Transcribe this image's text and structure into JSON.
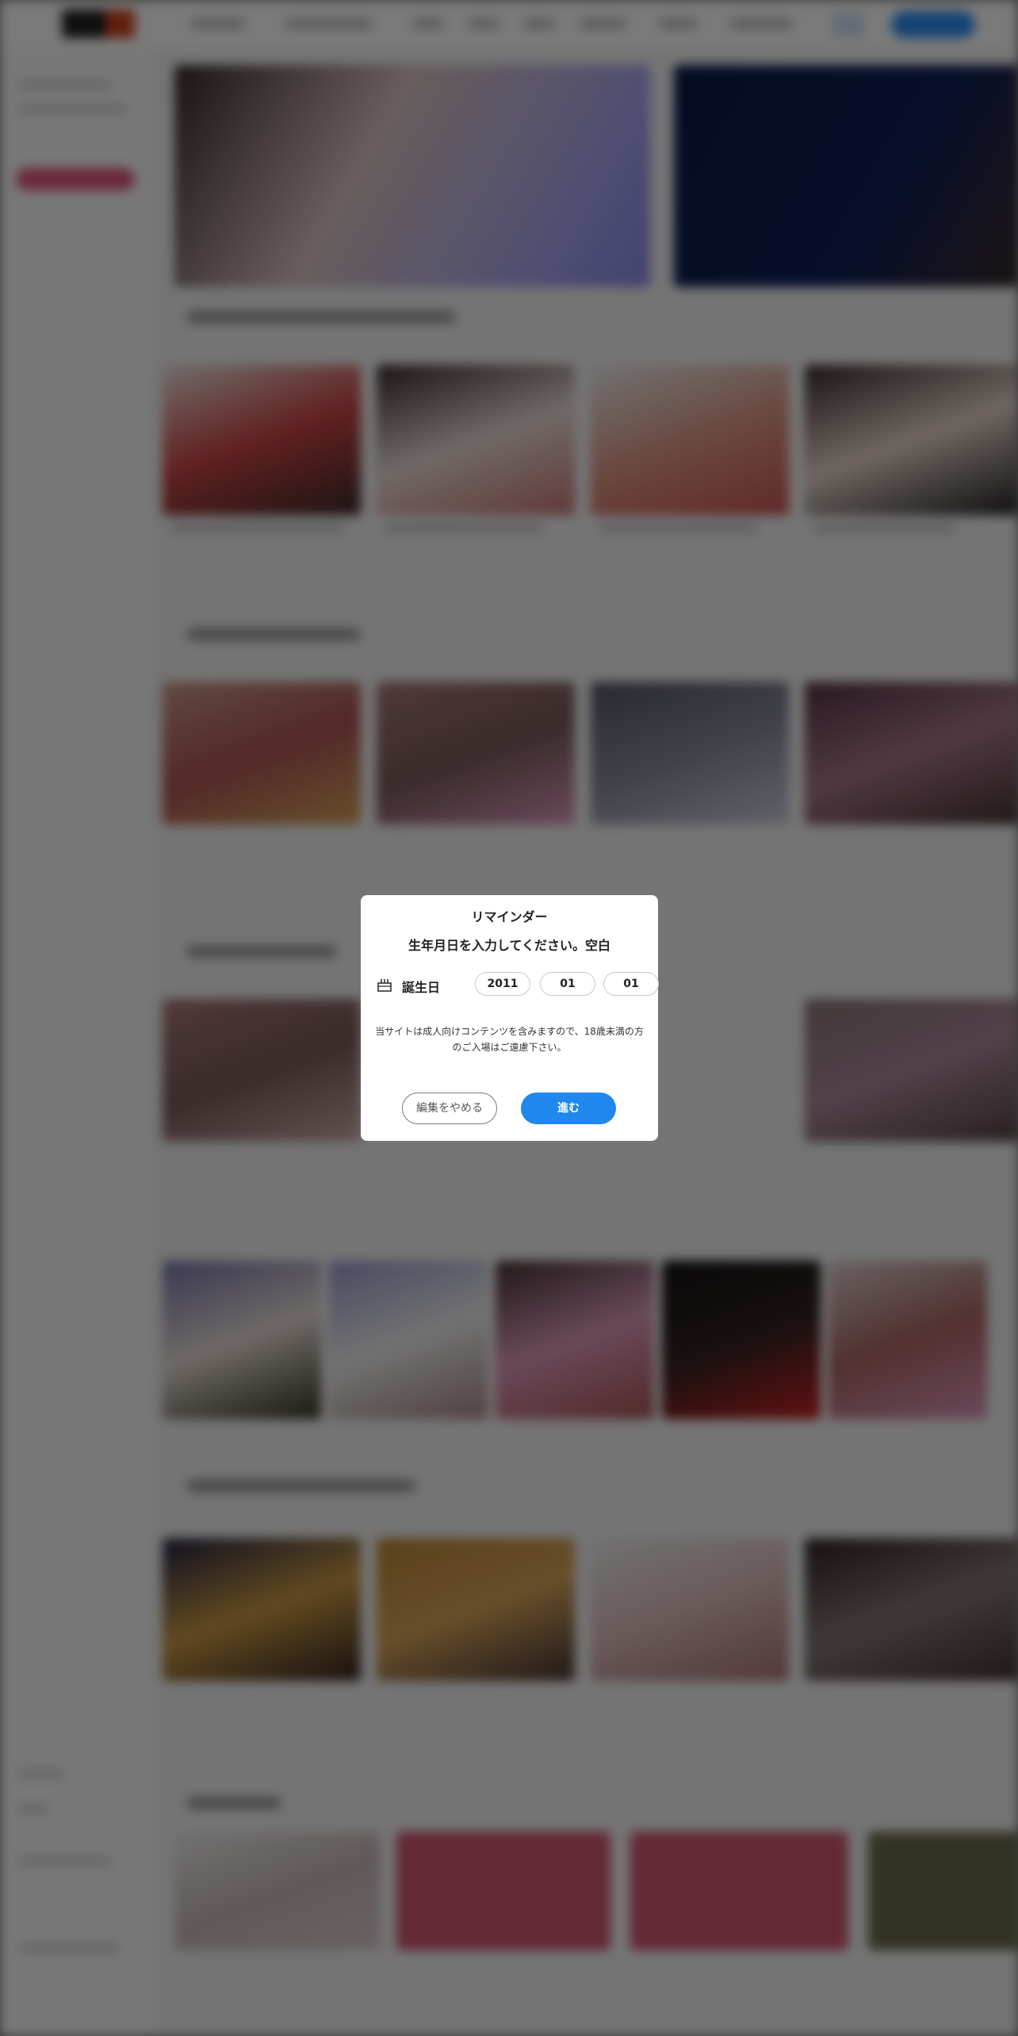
{
  "modal": {
    "title": "リマインダー",
    "subtitle": "生年月日を入力してください。空白",
    "birthday_label": "誕生日",
    "birthday_icon": "cake-icon",
    "year": "2011",
    "month": "01",
    "day": "01",
    "notice": "当サイトは成人向けコンテンツを含みますので、18歳未満の方のご入場はご遠慮下さい。",
    "cancel_label": "編集をやめる",
    "next_label": "進む"
  },
  "colors": {
    "primary": "#1f87ee",
    "overlay": "rgba(0,0,0,0.52)",
    "accent_pink": "#e0567d"
  }
}
